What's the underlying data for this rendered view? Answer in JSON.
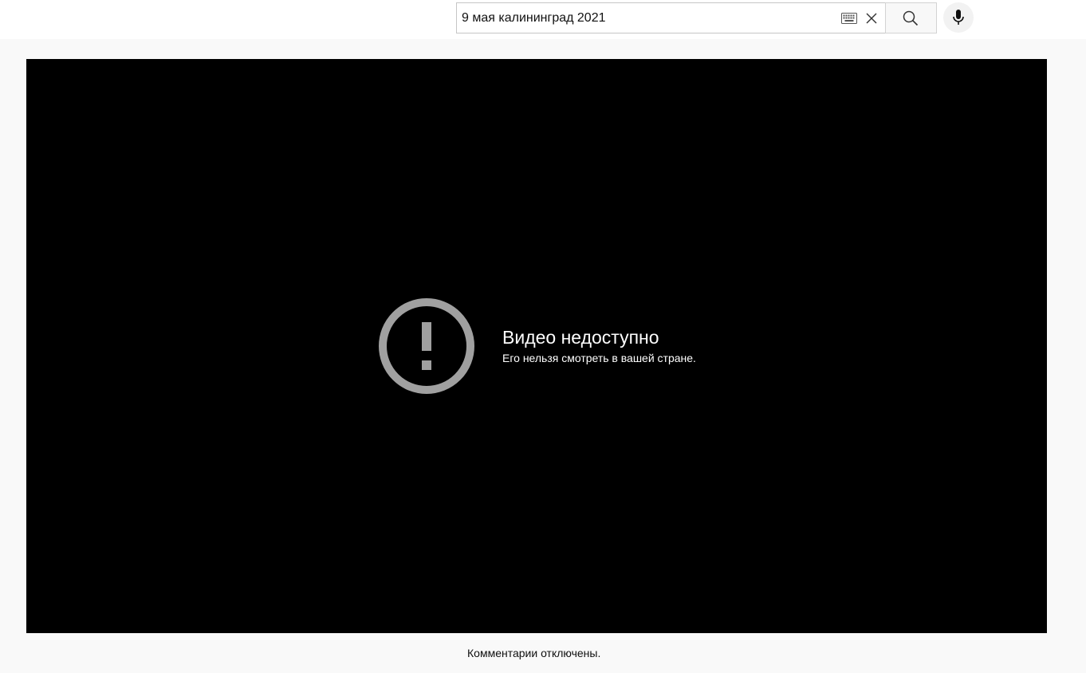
{
  "header": {
    "search": {
      "value": "9 мая калининград 2021",
      "keyboard_icon": "keyboard-icon",
      "clear_icon": "close-icon",
      "search_icon": "search-icon",
      "mic_icon": "microphone-icon"
    }
  },
  "player": {
    "error_icon": "exclamation-circle-icon",
    "error_title": "Видео недоступно",
    "error_message": "Его нельзя смотреть в вашей стране."
  },
  "comments": {
    "status": "Комментарии отключены."
  },
  "colors": {
    "player_background": "#000000",
    "error_icon": "#a0a0a0",
    "page_background": "#f9f9f9"
  }
}
